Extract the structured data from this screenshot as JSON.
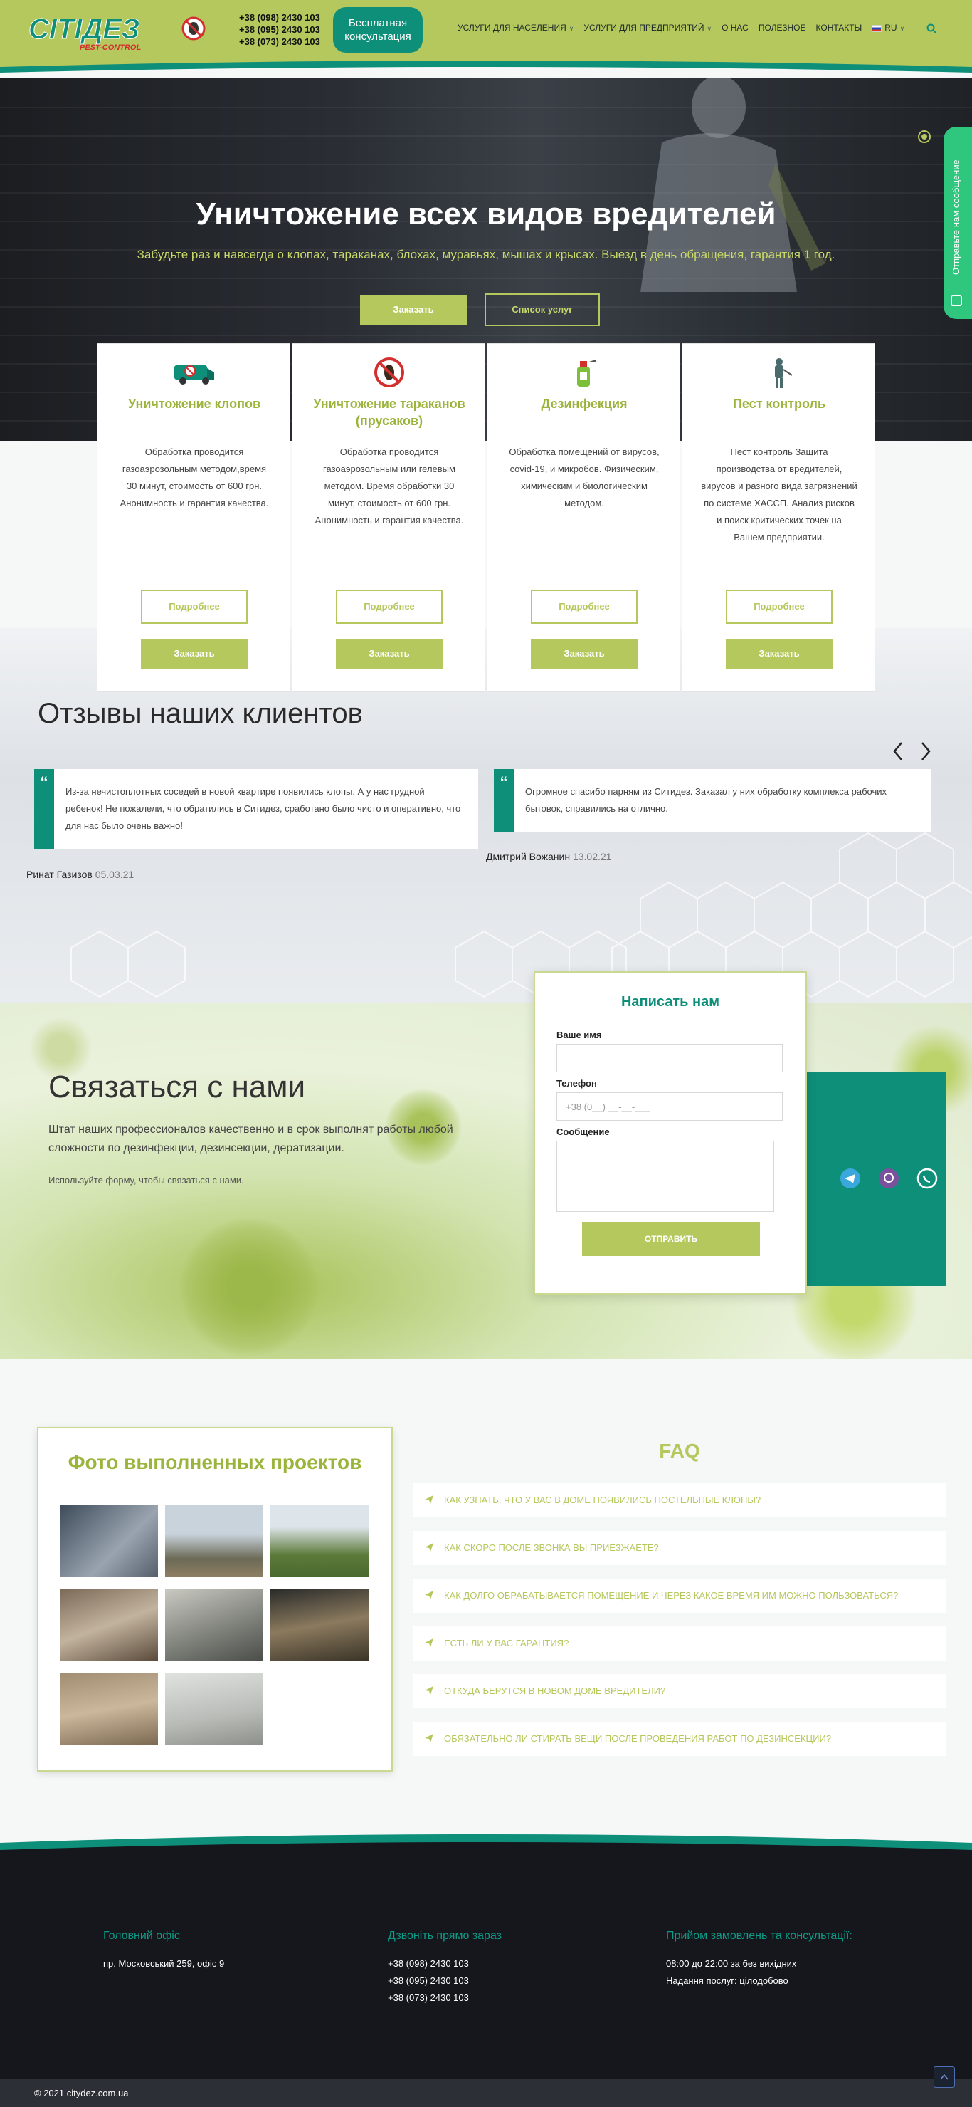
{
  "header": {
    "logo_text": "СІТІДЕЗ",
    "logo_sub": "PEST-CONTROL",
    "phones": [
      "+38 (098) 2430 103",
      "+38 (095) 2430 103",
      "+38 (073) 2430 103"
    ],
    "consult_button": "Бесплатная консультация",
    "nav": [
      {
        "label": "УСЛУГИ ДЛЯ НАСЕЛЕНИЯ",
        "dropdown": true
      },
      {
        "label": "УСЛУГИ ДЛЯ ПРЕДПРИЯТИЙ",
        "dropdown": true
      },
      {
        "label": "О НАС",
        "dropdown": false
      },
      {
        "label": "ПОЛЕЗНОЕ",
        "dropdown": false
      },
      {
        "label": "КОНТАКТЫ",
        "dropdown": false
      }
    ],
    "language": "RU",
    "colors": {
      "brand_green": "#b5c85d",
      "teal": "#0e8f7a"
    }
  },
  "hero": {
    "title": "Уничтожение всех видов вредителей",
    "subtitle": "Забудьте раз и навсегда о клопах, тараканах, блохах, муравьях, мышах и крысах. Выезд в день обращения, гарантия 1 год.",
    "order_button": "Заказать",
    "services_button": "Список услуг"
  },
  "side_tab": {
    "label": "Отправьте нам сообщение"
  },
  "services": [
    {
      "title": "Уничтожение клопов",
      "icon": "van-icon",
      "description": "Обработка проводится газоаэрозольным методом,время 30 минут, стоимость от 600 грн. Анонимность и гарантия качества.",
      "more": "Подробнее",
      "order": "Заказать"
    },
    {
      "title": "Уничтожение тараканов (прусаков)",
      "icon": "no-cockroach-icon",
      "description": "Обработка проводится газоаэрозольным или гелевым методом. Время обработки 30 минут, стоимость от 600 грн. Анонимность и гарантия качества.",
      "more": "Подробнее",
      "order": "Заказать"
    },
    {
      "title": "Дезинфекция",
      "icon": "sprayer-icon",
      "description": "Обработка помещений от вирусов, covid-19, и микробов. Физическим, химическим и биологическим методом.",
      "more": "Подробнее",
      "order": "Заказать"
    },
    {
      "title": "Пест контроль",
      "icon": "exterminator-icon",
      "description": "Пест контроль Защита производства от вредителей, вирусов и разного вида загрязнений по системе ХАССП. Анализ рисков и поиск критических точек на Вашем предприятии.",
      "more": "Подробнее",
      "order": "Заказать"
    }
  ],
  "reviews": {
    "title": "Отзывы наших клиентов",
    "items": [
      {
        "text": "Из-за нечистоплотных соседей в новой квартире появились клопы. А у нас грудной ребенок! Не пожалели, что обратились в Ситидез, сработано было чисто и оперативно, что для нас было очень важно!",
        "author": "Ринат Газизов",
        "date": "05.03.21"
      },
      {
        "text": "Огромное спасибо парням из Ситидез. Заказал у них обработку комплекса рабочих бытовок, справились на отлично.",
        "author": "Дмитрий Вожанин",
        "date": "13.02.21"
      }
    ]
  },
  "contact": {
    "title": "Связаться с нами",
    "description": "Штат наших профессионалов качественно и в срок выполнят работы любой сложности по дезинфекции, дезинсекции, дератизации.",
    "hint": "Используйте форму, чтобы связаться с нами.",
    "form": {
      "title": "Написать нам",
      "name_label": "Ваше имя",
      "phone_label": "Телефон",
      "phone_placeholder": "+38 (0__) __-__-___",
      "message_label": "Сообщение",
      "submit": "ОТПРАВИТЬ"
    },
    "messengers": [
      "telegram-icon",
      "viber-icon",
      "whatsapp-icon"
    ]
  },
  "projects": {
    "title": "Фото выполненных проектов",
    "photo_count": 8
  },
  "faq": {
    "title": "FAQ",
    "items": [
      "КАК УЗНАТЬ, ЧТО У ВАС В ДОМЕ ПОЯВИЛИСЬ ПОСТЕЛЬНЫЕ КЛОПЫ?",
      "КАК СКОРО ПОСЛЕ ЗВОНКА ВЫ ПРИЕЗЖАЕТЕ?",
      "КАК ДОЛГО ОБРАБАТЫВАЕТСЯ ПОМЕЩЕНИЕ И ЧЕРЕЗ КАКОЕ ВРЕМЯ ИМ МОЖНО ПОЛЬЗОВАТЬСЯ?",
      "ЕСТЬ ЛИ У ВАС ГАРАНТИЯ?",
      "ОТКУДА БЕРУТСЯ В НОВОМ ДОМЕ ВРЕДИТЕЛИ?",
      "ОБЯЗАТЕЛЬНО ЛИ СТИРАТЬ ВЕЩИ ПОСЛЕ ПРОВЕДЕНИЯ РАБОТ ПО ДЕЗИНСЕКЦИИ?"
    ]
  },
  "footer": {
    "office_title": "Головний офіс",
    "office_address": "пр. Московський 259, офіс 9",
    "call_title": "Дзвоніть прямо зараз",
    "phones": [
      "+38 (098) 2430 103",
      "+38 (095) 2430 103",
      "+38 (073) 2430 103"
    ],
    "orders_title": "Прийом замовлень та консультації:",
    "hours": "08:00 до 22:00 за без вихідних",
    "service_time": "Надання послуг: цілодобово",
    "copyright": "© 2021 citydez.com.ua"
  }
}
